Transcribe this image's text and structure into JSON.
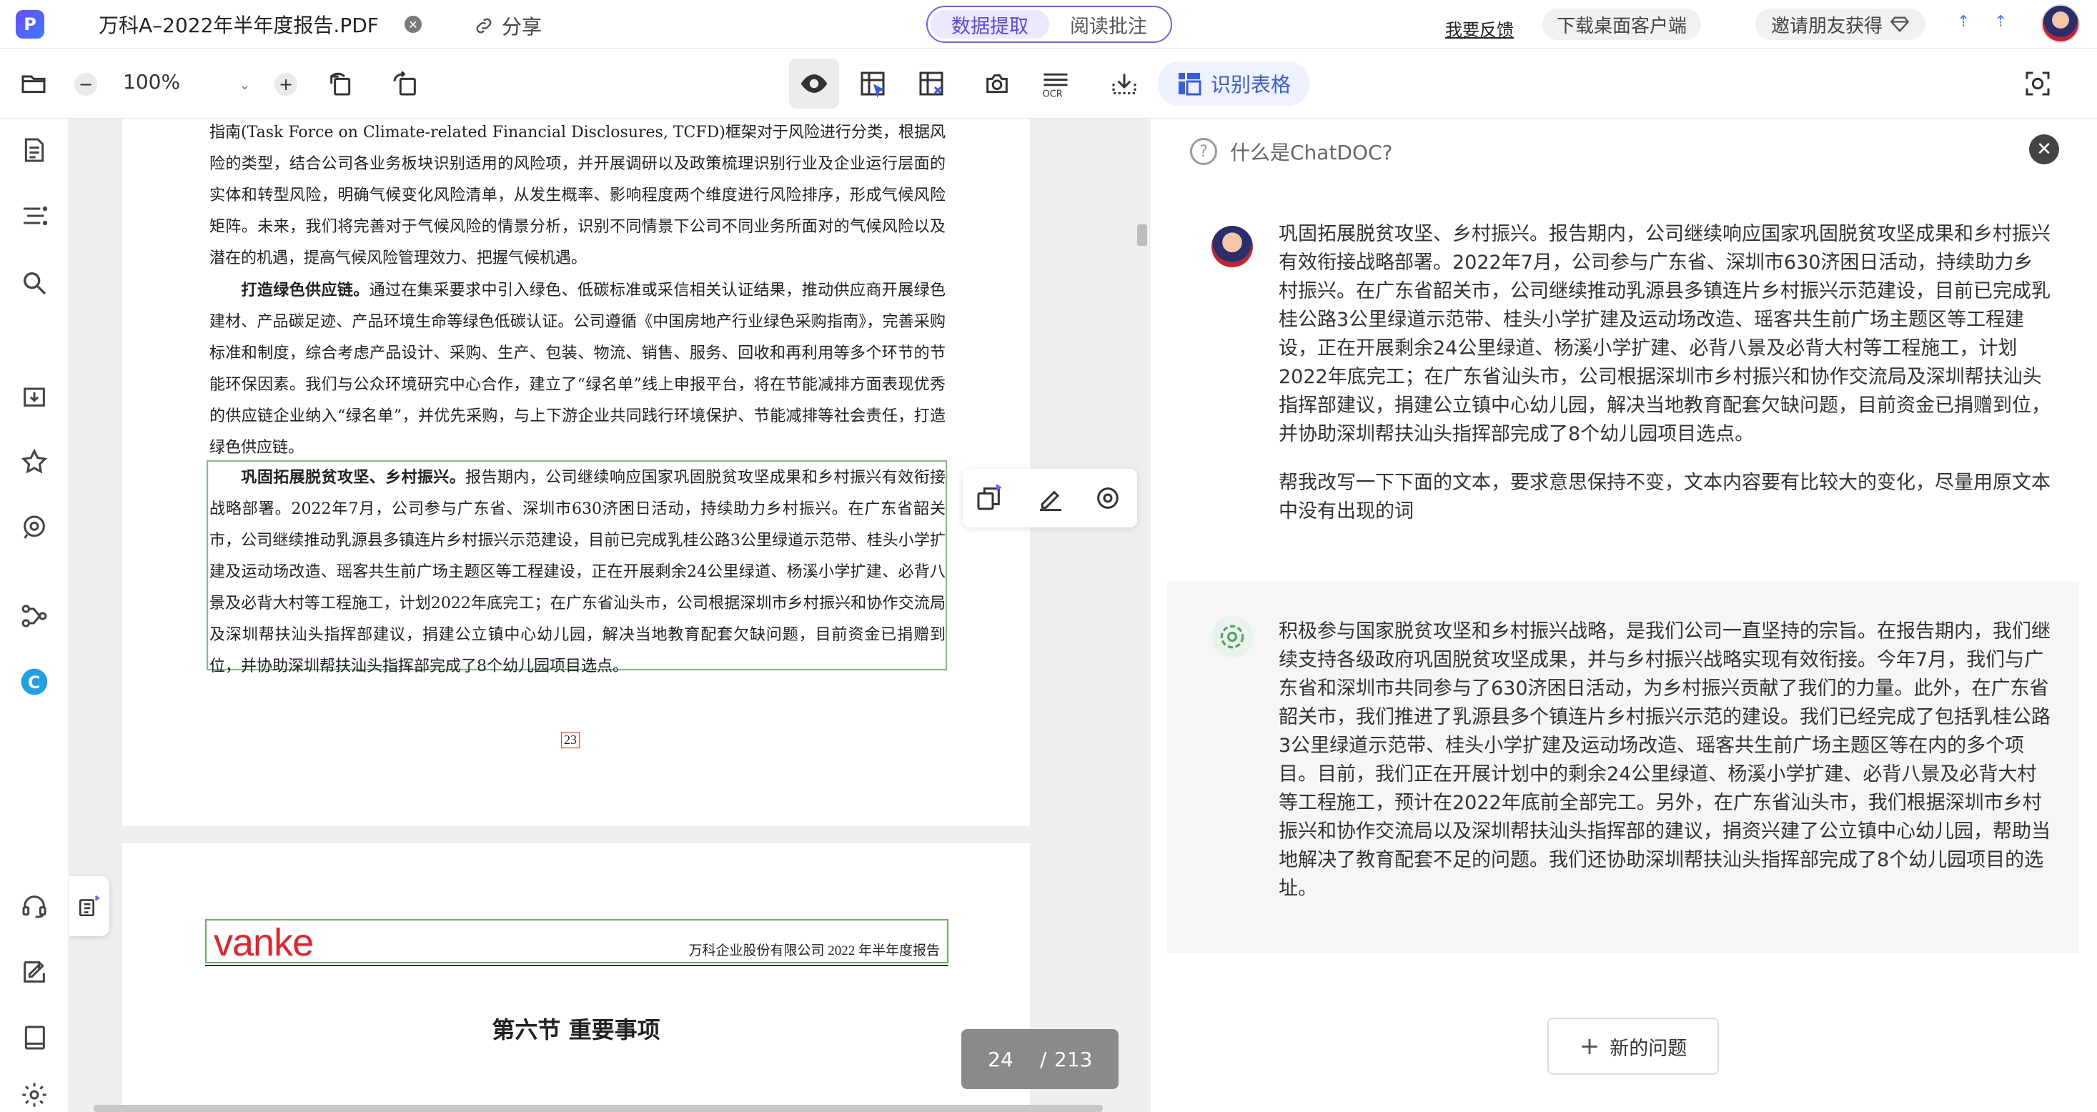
{
  "topbar": {
    "logo_letter": "P",
    "doc_title": "万科A–2022年半年度报告.PDF",
    "share_label": "分享",
    "modes": [
      "数据提取",
      "阅读批注"
    ],
    "feedback_label": "我要反馈",
    "download_label": "下载桌面客户端",
    "invite_label": "邀请朋友获得"
  },
  "toolbar": {
    "zoom_value": "100%",
    "table_detect_label": "识别表格"
  },
  "pdf": {
    "page1_paragraphs": [
      "指南(Task Force on Climate-related Financial Disclosures, TCFD)框架对于风险进行分类，根据风险的类型，结合公司各业务板块识别适用的风险项，并开展调研以及政策梳理识别行业及企业运行层面的实体和转型风险，明确气候变化风险清单，从发生概率、影响程度两个维度进行风险排序，形成气候风险矩阵。未来，我们将完善对于气候风险的情景分析，识别不同情景下公司不同业务所面对的气候风险以及潜在的机遇，提高气候风险管理效力、把握气候机遇。"
    ],
    "p2_bold": "打造绿色供应链。",
    "p2_text": "通过在集采要求中引入绿色、低碳标准或采信相关认证结果，推动供应商开展绿色建材、产品碳足迹、产品环境生命等绿色低碳认证。公司遵循《中国房地产行业绿色采购指南》，完善采购标准和制度，综合考虑产品设计、采购、生产、包装、物流、销售、服务、回收和再利用等多个环节的节能环保因素。我们与公众环境研究中心合作，建立了“绿名单”线上申报平台，将在节能减排方面表现优秀的供应链企业纳入“绿名单”，并优先采购，与上下游企业共同践行环境保护、节能减排等社会责任，打造绿色供应链。",
    "p3_bold": "巩固拓展脱贫攻坚、乡村振兴。",
    "p3_text": "报告期内，公司继续响应国家巩固脱贫攻坚成果和乡村振兴有效衔接战略部署。2022年7月，公司参与广东省、深圳市630济困日活动，持续助力乡村振兴。在广东省韶关市，公司继续推动乳源县多镇连片乡村振兴示范建设，目前已完成乳桂公路3公里绿道示范带、桂头小学扩建及运动场改造、瑶客共生前广场主题区等工程建设，正在开展剩余24公里绿道、杨溪小学扩建、必背八景及必背大村等工程施工，计划2022年底完工；在广东省汕头市，公司根据深圳市乡村振兴和协作交流局及深圳帮扶汕头指挥部建议，捐建公立镇中心幼儿园，解决当地教育配套欠缺问题，目前资金已捐赠到位，并协助深圳帮扶汕头指挥部完成了8个幼儿园项目选点。",
    "page1_number": "23",
    "page2_logo": "vanke",
    "page2_header_right": "万科企业股份有限公司 2022 年半年度报告",
    "page2_section_title": "第六节  重要事项",
    "page_current": "24",
    "page_total": "213"
  },
  "chat": {
    "header_title": "什么是ChatDOC?",
    "user_msg_1": "巩固拓展脱贫攻坚、乡村振兴。报告期内，公司继续响应国家巩固脱贫攻坚成果和乡村振兴有效衔接战略部署。2022年7月，公司参与广东省、深圳市630济困日活动，持续助力乡村振兴。在广东省韶关市，公司继续推动乳源县多镇连片乡村振兴示范建设，目前已完成乳桂公路3公里绿道示范带、桂头小学扩建及运动场改造、瑶客共生前广场主题区等工程建设，正在开展剩余24公里绿道、杨溪小学扩建、必背八景及必背大村等工程施工，计划2022年底完工；在广东省汕头市，公司根据深圳市乡村振兴和协作交流局及深圳帮扶汕头指挥部建议，捐建公立镇中心幼儿园，解决当地教育配套欠缺问题，目前资金已捐赠到位，并协助深圳帮扶汕头指挥部完成了8个幼儿园项目选点。",
    "user_msg_2": "帮我改写一下下面的文本，要求意思保持不变，文本内容要有比较大的变化，尽量用原文本中没有出现的词",
    "bot_msg": "积极参与国家脱贫攻坚和乡村振兴战略，是我们公司一直坚持的宗旨。在报告期内，我们继续支持各级政府巩固脱贫攻坚成果，并与乡村振兴战略实现有效衔接。今年7月，我们与广东省和深圳市共同参与了630济困日活动，为乡村振兴贡献了我们的力量。此外，在广东省韶关市，我们推进了乳源县多个镇连片乡村振兴示范的建设。我们已经完成了包括乳桂公路3公里绿道示范带、桂头小学扩建及运动场改造、瑶客共生前广场主题区等在内的多个项目。目前，我们正在开展计划中的剩余24公里绿道、杨溪小学扩建、必背八景及必背大村等工程施工，预计在2022年底前全部完工。另外，在广东省汕头市，我们根据深圳市乡村振兴和协作交流局以及深圳帮扶汕头指挥部的建议，捐资兴建了公立镇中心幼儿园，帮助当地解决了教育配套不足的问题。我们还协助深圳帮扶汕头指挥部完成了8个幼儿园项目的选址。",
    "new_question_label": "新的问题"
  },
  "colors": {
    "accent": "#5c4ae4",
    "selection": "#7ec17a",
    "brand_red": "#e1242c"
  }
}
